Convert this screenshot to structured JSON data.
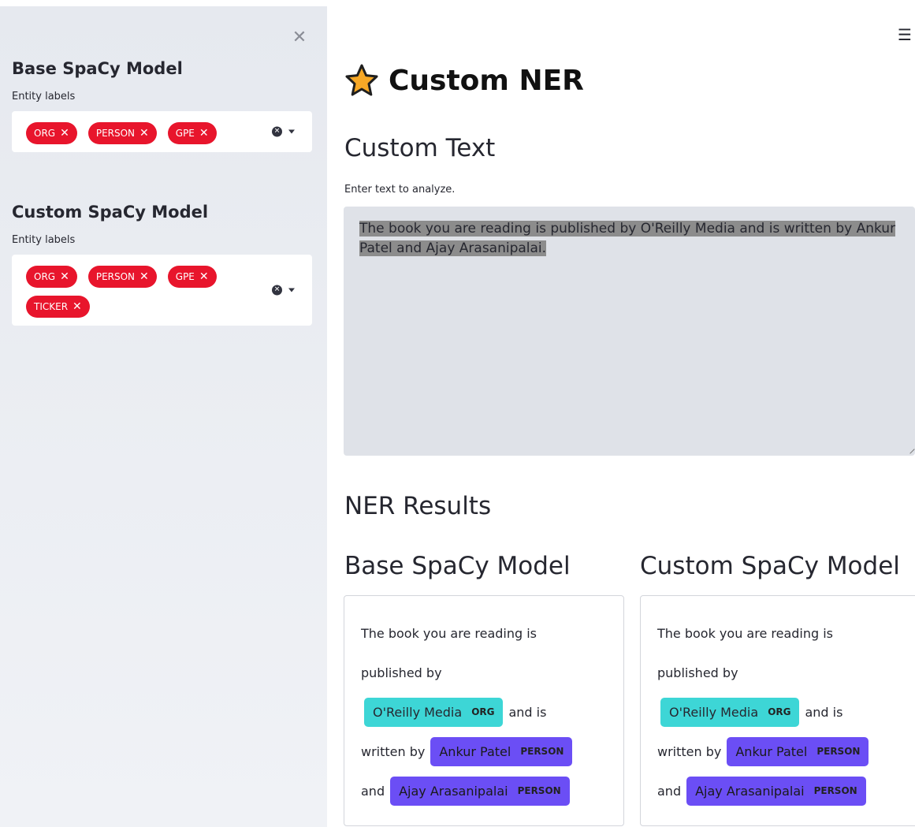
{
  "sidebar": {
    "close_icon": "close-icon",
    "base_model": {
      "heading": "Base SpaCy Model",
      "field_label": "Entity labels",
      "chips": [
        "ORG",
        "PERSON",
        "GPE"
      ]
    },
    "custom_model": {
      "heading": "Custom SpaCy Model",
      "field_label": "Entity labels",
      "chips": [
        "ORG",
        "PERSON",
        "GPE",
        "TICKER"
      ]
    }
  },
  "header": {
    "menu_icon": "hamburger-menu-icon"
  },
  "main": {
    "title": "Custom NER",
    "title_icon": "star-icon",
    "custom_text_heading": "Custom Text",
    "input_label": "Enter text to analyze.",
    "input_value": "The book you are reading is published by O'Reilly Media and is written by Ankur Patel and Ajay Arasanipalai.",
    "results_heading": "NER Results",
    "base_results": {
      "heading": "Base SpaCy Model",
      "lines": [
        {
          "text": "The book you are reading is"
        },
        {
          "text": "published by"
        },
        {
          "entity": "O'Reilly Media",
          "label": "ORG",
          "after": "and is"
        },
        {
          "before": "written by",
          "entity": "Ankur Patel",
          "label": "PERSON"
        },
        {
          "before": "and",
          "entity": "Ajay Arasanipalai",
          "label": "PERSON"
        }
      ]
    },
    "custom_results": {
      "heading": "Custom SpaCy Model",
      "lines": [
        {
          "text": "The book you are reading is"
        },
        {
          "text": "published by"
        },
        {
          "entity": "O'Reilly Media",
          "label": "ORG",
          "after": "and is"
        },
        {
          "before": "written by",
          "entity": "Ankur Patel",
          "label": "PERSON"
        },
        {
          "before": "and",
          "entity": "Ajay Arasanipalai",
          "label": "PERSON"
        }
      ]
    }
  },
  "colors": {
    "chip": "#e8152c",
    "org_entity": "#3dd6d6",
    "person_entity": "#6b4ef5",
    "sidebar_bg": "#f0f2f6",
    "textarea_bg": "#dfe2e8",
    "star": "#f7a826"
  }
}
